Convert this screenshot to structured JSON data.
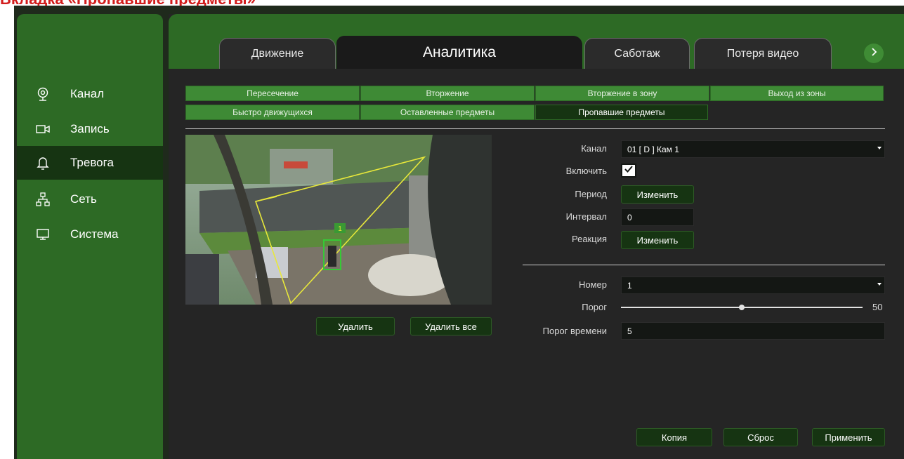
{
  "page_heading": "Вкладка «Пропавшие предметы»",
  "sidebar": {
    "items": [
      {
        "label": "Канал",
        "icon": "camera-lens-icon"
      },
      {
        "label": "Запись",
        "icon": "video-camera-icon"
      },
      {
        "label": "Тревога",
        "icon": "bell-icon",
        "active": true
      },
      {
        "label": "Сеть",
        "icon": "network-icon"
      },
      {
        "label": "Система",
        "icon": "monitor-icon"
      }
    ]
  },
  "tabs": [
    {
      "label": "Движение"
    },
    {
      "label": "Аналитика",
      "active": true
    },
    {
      "label": "Саботаж"
    },
    {
      "label": "Потеря видео"
    }
  ],
  "subtabs": [
    {
      "label": "Пересечение"
    },
    {
      "label": "Вторжение"
    },
    {
      "label": "Вторжение в зону"
    },
    {
      "label": "Выход из зоны"
    },
    {
      "label": "Быстро движущихся"
    },
    {
      "label": "Оставленные предметы"
    },
    {
      "label": "Пропавшие предметы",
      "active": true
    }
  ],
  "preview": {
    "zone_number": "1"
  },
  "preview_buttons": {
    "delete": "Удалить",
    "delete_all": "Удалить все"
  },
  "settings": {
    "channel": {
      "label": "Канал",
      "value": "01 [ D ] Кам 1"
    },
    "enable": {
      "label": "Включить",
      "checked": true
    },
    "period": {
      "label": "Период",
      "button": "Изменить"
    },
    "interval": {
      "label": "Интервал",
      "value": "0"
    },
    "reaction": {
      "label": "Реакция",
      "button": "Изменить"
    }
  },
  "zone": {
    "number": {
      "label": "Номер",
      "value": "1"
    },
    "threshold": {
      "label": "Порог",
      "value": "50",
      "fraction": 0.5
    },
    "time_threshold": {
      "label": "Порог времени",
      "value": "5"
    }
  },
  "footer": {
    "copy": "Копия",
    "reset": "Сброс",
    "apply": "Применить"
  },
  "colors": {
    "accent_green": "#2d6a25",
    "dark_green": "#163412",
    "zone_line": "#e8e83a",
    "object_box": "#36c936"
  }
}
